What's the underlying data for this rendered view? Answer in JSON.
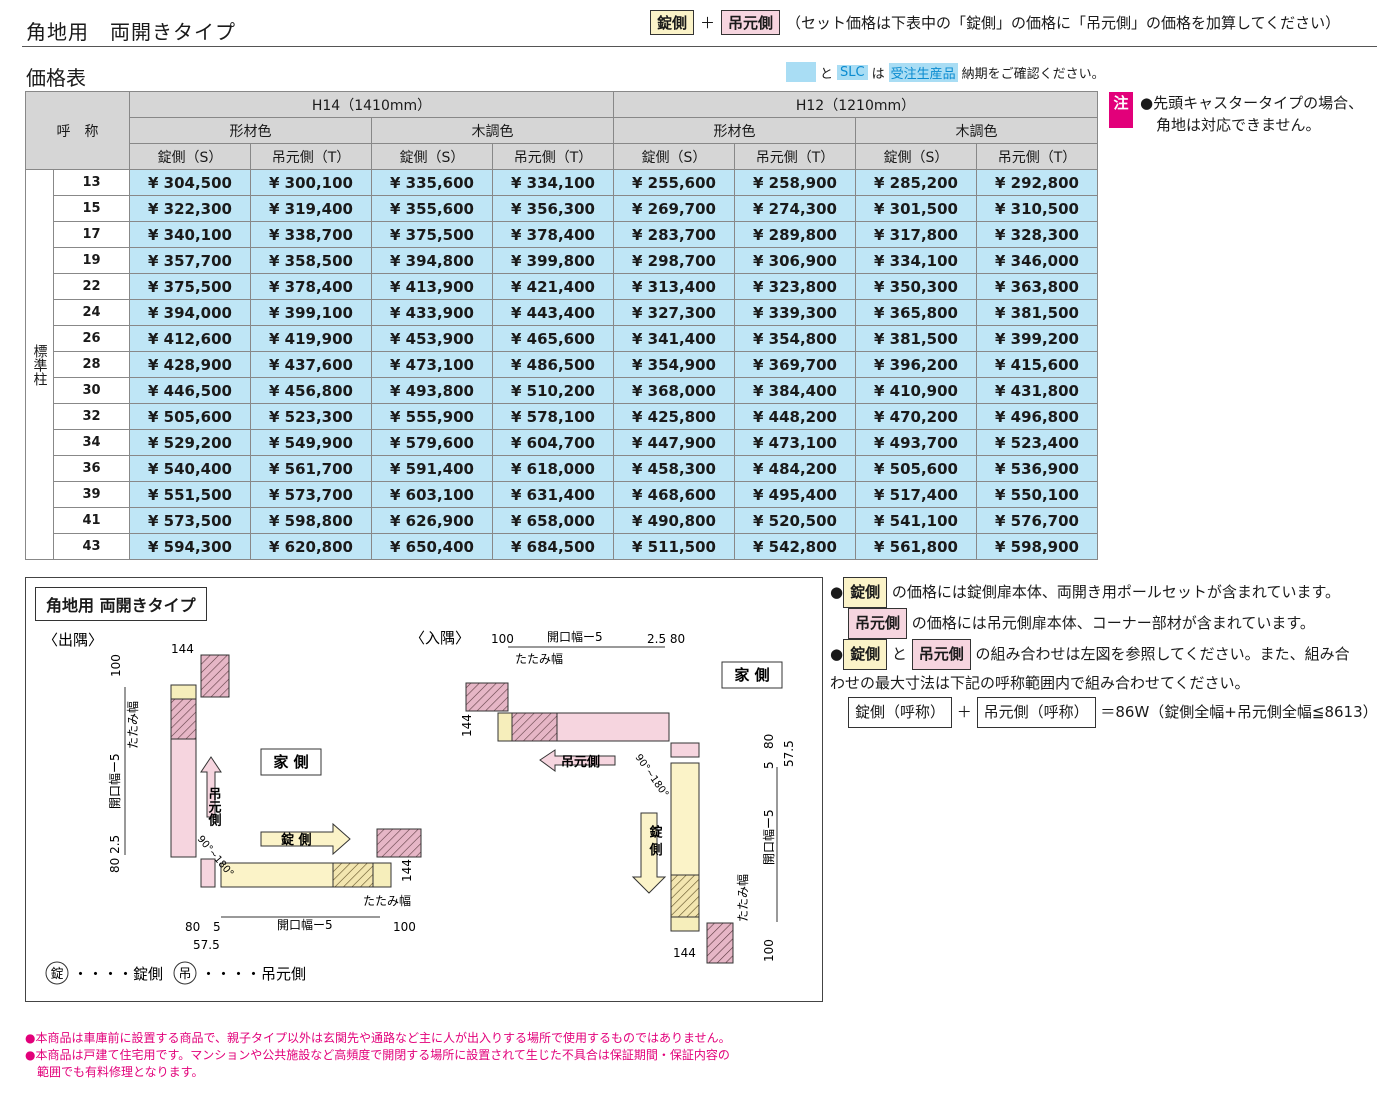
{
  "header": {
    "title": "角地用　両開きタイプ",
    "legend_kagi": "錠側",
    "legend_tsuri": "吊元側",
    "plus": "＋",
    "set_note": "（セット価格は下表中の「錠側」の価格に「吊元側」の価格を加算してください）"
  },
  "price": {
    "title": "価格表",
    "note_and": "と",
    "note_slc": "SLC",
    "note_ha": "は",
    "note_made": "受注生産品",
    "note_tail": "納期をご確認ください。"
  },
  "table": {
    "h_name": "呼　称",
    "h14": "H14（1410mm）",
    "h12": "H12（1210mm）",
    "shape": "形材色",
    "wood": "木調色",
    "s": "錠側（S）",
    "t": "吊元側（T）",
    "side_label": "標準柱",
    "rows": [
      {
        "n": "13",
        "v": [
          "¥ 304,500",
          "¥ 300,100",
          "¥ 335,600",
          "¥ 334,100",
          "¥ 255,600",
          "¥ 258,900",
          "¥ 285,200",
          "¥ 292,800"
        ]
      },
      {
        "n": "15",
        "v": [
          "¥ 322,300",
          "¥ 319,400",
          "¥ 355,600",
          "¥ 356,300",
          "¥ 269,700",
          "¥ 274,300",
          "¥ 301,500",
          "¥ 310,500"
        ]
      },
      {
        "n": "17",
        "v": [
          "¥ 340,100",
          "¥ 338,700",
          "¥ 375,500",
          "¥ 378,400",
          "¥ 283,700",
          "¥ 289,800",
          "¥ 317,800",
          "¥ 328,300"
        ]
      },
      {
        "n": "19",
        "v": [
          "¥ 357,700",
          "¥ 358,500",
          "¥ 394,800",
          "¥ 399,800",
          "¥ 298,700",
          "¥ 306,900",
          "¥ 334,100",
          "¥ 346,000"
        ]
      },
      {
        "n": "22",
        "v": [
          "¥ 375,500",
          "¥ 378,400",
          "¥ 413,900",
          "¥ 421,400",
          "¥ 313,400",
          "¥ 323,800",
          "¥ 350,300",
          "¥ 363,800"
        ]
      },
      {
        "n": "24",
        "v": [
          "¥ 394,000",
          "¥ 399,100",
          "¥ 433,900",
          "¥ 443,400",
          "¥ 327,300",
          "¥ 339,300",
          "¥ 365,800",
          "¥ 381,500"
        ]
      },
      {
        "n": "26",
        "v": [
          "¥ 412,600",
          "¥ 419,900",
          "¥ 453,900",
          "¥ 465,600",
          "¥ 341,400",
          "¥ 354,800",
          "¥ 381,500",
          "¥ 399,200"
        ]
      },
      {
        "n": "28",
        "v": [
          "¥ 428,900",
          "¥ 437,600",
          "¥ 473,100",
          "¥ 486,500",
          "¥ 354,900",
          "¥ 369,700",
          "¥ 396,200",
          "¥ 415,600"
        ]
      },
      {
        "n": "30",
        "v": [
          "¥ 446,500",
          "¥ 456,800",
          "¥ 493,800",
          "¥ 510,200",
          "¥ 368,000",
          "¥ 384,400",
          "¥ 410,900",
          "¥ 431,800"
        ]
      },
      {
        "n": "32",
        "v": [
          "¥ 505,600",
          "¥ 523,300",
          "¥ 555,900",
          "¥ 578,100",
          "¥ 425,800",
          "¥ 448,200",
          "¥ 470,200",
          "¥ 496,800"
        ]
      },
      {
        "n": "34",
        "v": [
          "¥ 529,200",
          "¥ 549,900",
          "¥ 579,600",
          "¥ 604,700",
          "¥ 447,900",
          "¥ 473,100",
          "¥ 493,700",
          "¥ 523,400"
        ]
      },
      {
        "n": "36",
        "v": [
          "¥ 540,400",
          "¥ 561,700",
          "¥ 591,400",
          "¥ 618,000",
          "¥ 458,300",
          "¥ 484,200",
          "¥ 505,600",
          "¥ 536,900"
        ]
      },
      {
        "n": "39",
        "v": [
          "¥ 551,500",
          "¥ 573,700",
          "¥ 603,100",
          "¥ 631,400",
          "¥ 468,600",
          "¥ 495,400",
          "¥ 517,400",
          "¥ 550,100"
        ]
      },
      {
        "n": "41",
        "v": [
          "¥ 573,500",
          "¥ 598,800",
          "¥ 626,900",
          "¥ 658,000",
          "¥ 490,800",
          "¥ 520,500",
          "¥ 541,100",
          "¥ 576,700"
        ]
      },
      {
        "n": "43",
        "v": [
          "¥ 594,300",
          "¥ 620,800",
          "¥ 650,400",
          "¥ 684,500",
          "¥ 511,500",
          "¥ 542,800",
          "¥ 561,800",
          "¥ 598,900"
        ]
      }
    ]
  },
  "side_note": {
    "mark": "注",
    "line1": "●先頭キャスタータイプの場合、",
    "line2": "角地は対応できません。"
  },
  "diagram": {
    "title": "角地用 両開きタイプ",
    "out_label": "〈出隅〉",
    "in_label": "〈入隅〉",
    "house": "家 側",
    "kagi": "錠 側",
    "tsuri": "吊元側",
    "open_w": "開口幅ー5",
    "fold_w": "たたみ幅",
    "angle": "90°~180°",
    "kagi_mark": "錠",
    "tsuri_mark": "吊",
    "d144": "144",
    "d100": "100",
    "d80": "80",
    "d25": "2.5",
    "d5": "5",
    "d575": "57.5",
    "d8025": "80 2.5",
    "d2580": "2.5 80",
    "legend_kagi": "・・・・錠側",
    "legend_tsuri": "・・・・吊元側"
  },
  "right_notes": {
    "b1_pre": "●",
    "kagi": "錠側",
    "b1_text": "の価格には錠側扉本体、両開き用ポールセットが含まれています。",
    "tsuri": "吊元側",
    "b2_text": "の価格には吊元側扉本体、コーナー部材が含まれています。",
    "b3_to": "と",
    "b3_text": "の組み合わせは左図を参照してください。また、組み合",
    "b3_line2": "わせの最大寸法は下記の呼称範囲内で組み合わせてください。",
    "f_kagi": "錠側（呼称）",
    "f_plus": "＋",
    "f_tsuri": "吊元側（呼称）",
    "f_tail": "＝86W（錠側全幅+吊元側全幅≦8613）"
  },
  "bottom_notes": {
    "l1": "●本商品は車庫前に設置する商品で、親子タイプ以外は玄関先や通路など主に人が出入りする場所で使用するものではありません。",
    "l2": "●本商品は戸建て住宅用です。マンションや公共施設など高頻度で開閉する場所に設置されて生じた不具合は保証期間・保証内容の",
    "l3": "　範囲でも有料修理となります。"
  },
  "colors": {
    "price_bg": "#bfe6f6",
    "header_bg": "#d6d6d6",
    "kagi_bg": "#fbf3c8",
    "tsuri_bg": "#f6d5df",
    "accent": "#e2007a"
  }
}
